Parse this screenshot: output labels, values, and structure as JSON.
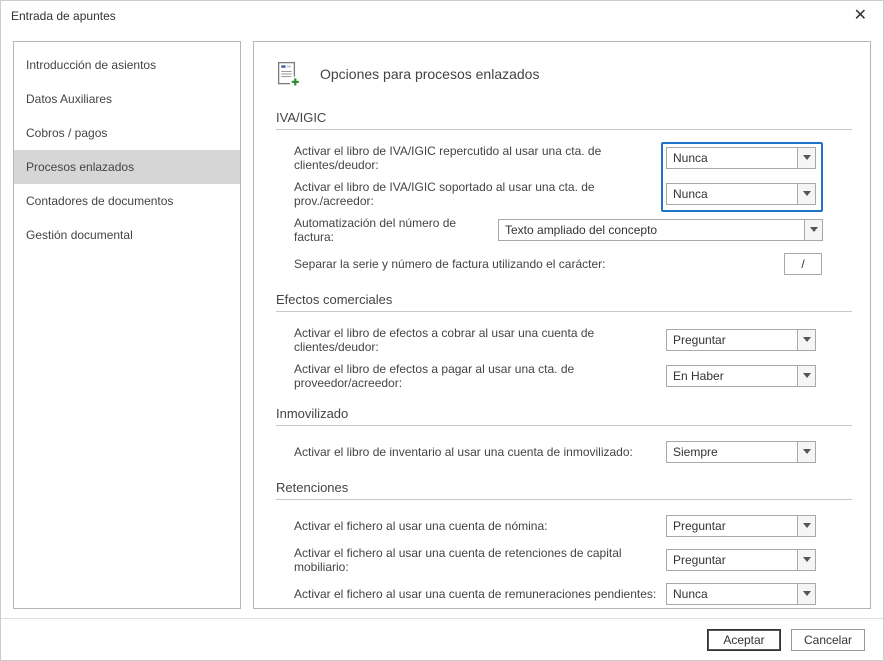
{
  "window": {
    "title": "Entrada de apuntes"
  },
  "sidebar": {
    "items": [
      {
        "label": "Introducción de asientos"
      },
      {
        "label": "Datos Auxiliares"
      },
      {
        "label": "Cobros / pagos"
      },
      {
        "label": "Procesos enlazados"
      },
      {
        "label": "Contadores de documentos"
      },
      {
        "label": "Gestión documental"
      }
    ],
    "selected_index": 3
  },
  "header": {
    "title": "Opciones para procesos enlazados"
  },
  "sections": {
    "iva": {
      "title": "IVA/IGIC",
      "row1_label": "Activar el libro de IVA/IGIC repercutido al usar una cta. de clientes/deudor:",
      "row1_value": "Nunca",
      "row2_label": "Activar el libro de IVA/IGIC soportado al usar una cta. de prov./acreedor:",
      "row2_value": "Nunca",
      "row3_label": "Automatización del número de factura:",
      "row3_value": "Texto ampliado del concepto",
      "row4_label": "Separar la serie y número de factura utilizando el carácter:",
      "row4_value": "/"
    },
    "efectos": {
      "title": "Efectos comerciales",
      "row1_label": "Activar el libro de efectos a cobrar al usar una cuenta de clientes/deudor:",
      "row1_value": "Preguntar",
      "row2_label": "Activar el libro de efectos a pagar al usar una cta. de proveedor/acreedor:",
      "row2_value": "En Haber"
    },
    "inmov": {
      "title": "Inmovilizado",
      "row1_label": "Activar el libro de inventario al usar una cuenta de inmovilizado:",
      "row1_value": "Siempre"
    },
    "ret": {
      "title": "Retenciones",
      "row1_label": "Activar el fichero al usar una cuenta de nómina:",
      "row1_value": "Preguntar",
      "row2_label": "Activar el fichero al usar una cuenta de retenciones de capital mobiliario:",
      "row2_value": "Preguntar",
      "row3_label": "Activar el fichero al usar una cuenta de remuneraciones pendientes:",
      "row3_value": "Nunca"
    }
  },
  "footer": {
    "ok": "Aceptar",
    "cancel": "Cancelar"
  }
}
